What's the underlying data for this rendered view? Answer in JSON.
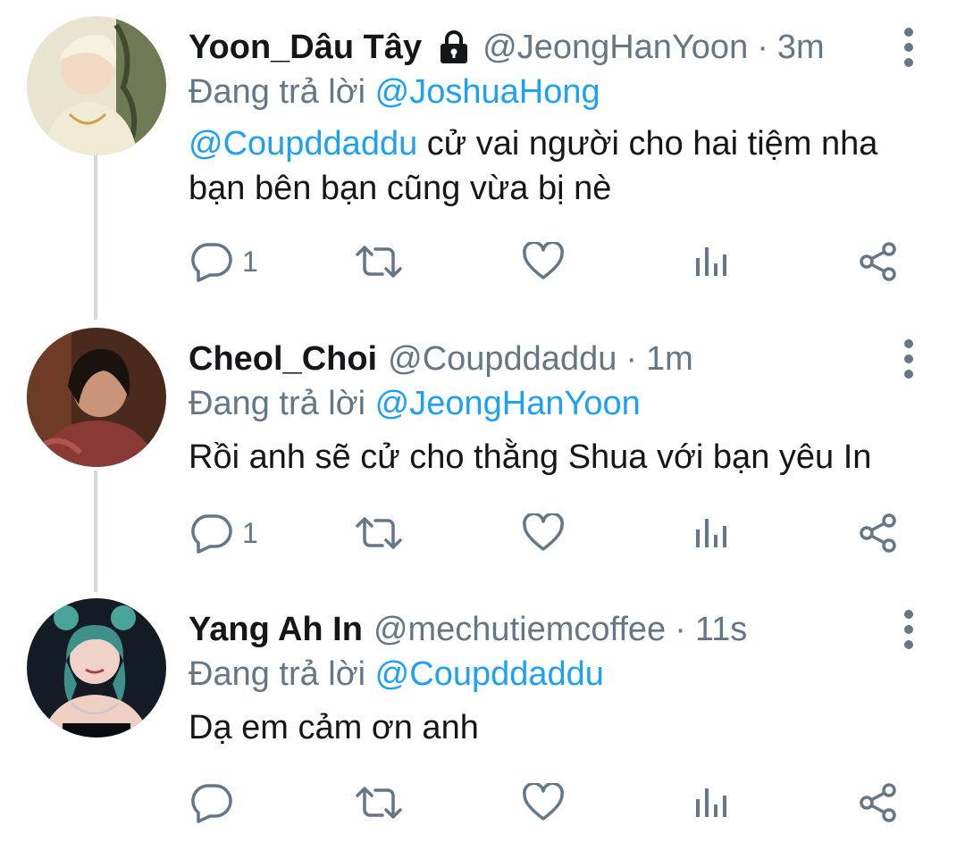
{
  "tweets": [
    {
      "name": "Yoon_Dâu Tây",
      "locked": true,
      "handle": "@JeongHanYoon",
      "dot": "·",
      "time": "3m",
      "replying_prefix": "Đang trả lời",
      "replying_to": "@JoshuaHong",
      "body_mention": "@Coupddaddu",
      "body_text": " cử vai người cho hai tiệm nha bạn bên bạn cũng vừa bị nè",
      "reply_count": "1",
      "avatar_colors": [
        "#efe8d6",
        "#d9d3b8"
      ]
    },
    {
      "name": "Cheol_Choi",
      "locked": false,
      "handle": "@Coupddaddu",
      "dot": "·",
      "time": "1m",
      "replying_prefix": "Đang trả lời",
      "replying_to": "@JeongHanYoon",
      "body_mention": "",
      "body_text": "Rồi anh sẽ cử cho thằng Shua với bạn yêu In",
      "reply_count": "1",
      "avatar_colors": [
        "#3b2318",
        "#7a3a2a"
      ]
    },
    {
      "name": "Yang Ah In",
      "locked": false,
      "handle": "@mechutiemcoffee",
      "dot": "·",
      "time": "11s",
      "replying_prefix": "Đang trả lời",
      "replying_to": "@Coupddaddu",
      "body_mention": "",
      "body_text": "Dạ em cảm ơn anh",
      "reply_count": "",
      "avatar_colors": [
        "#141a22",
        "#3f8f8a"
      ]
    }
  ],
  "colors": {
    "text": "#14171a",
    "secondary": "#657786",
    "link": "#1da1f2",
    "thread_line": "#cfd9de"
  },
  "icons": [
    "lock-icon",
    "more-icon",
    "reply-icon",
    "retweet-icon",
    "like-icon",
    "analytics-icon",
    "share-icon"
  ]
}
